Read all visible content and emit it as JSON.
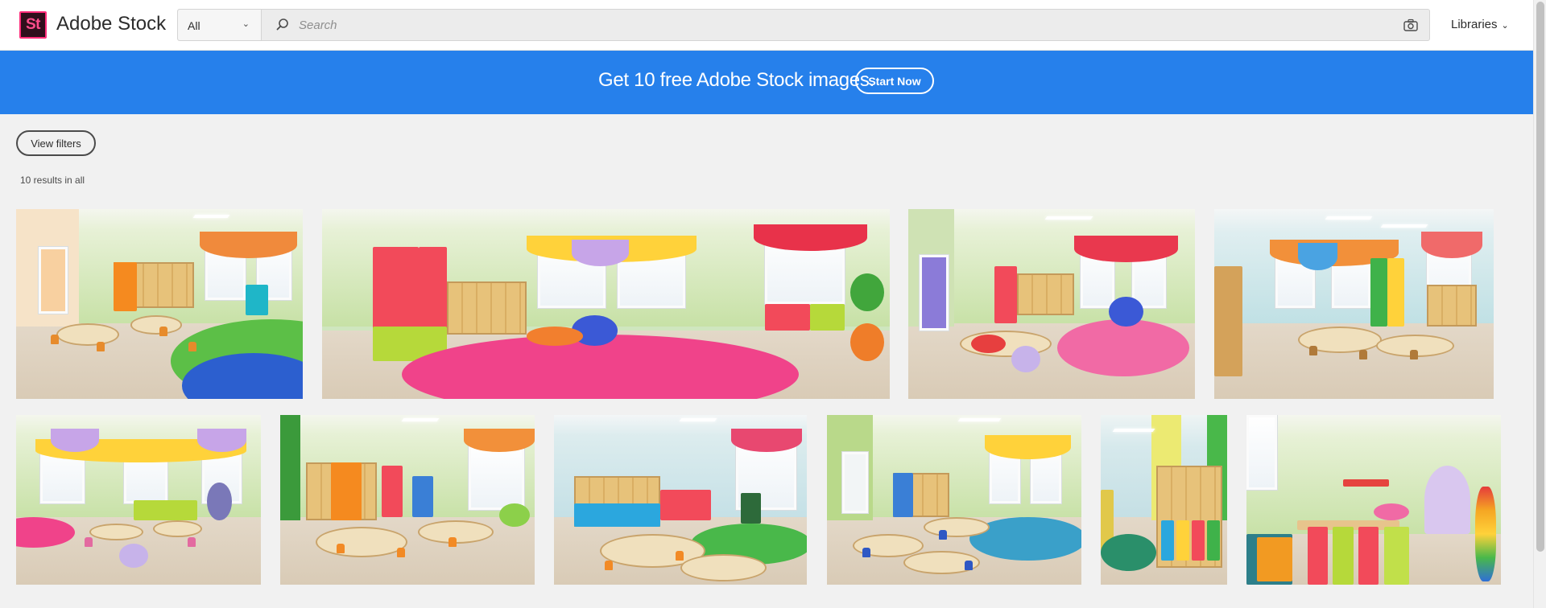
{
  "header": {
    "logo_text": "St",
    "brand": "Adobe Stock",
    "filter_value": "All",
    "search_placeholder": "Search",
    "libraries_label": "Libraries"
  },
  "banner": {
    "text": "Get 10 free Adobe Stock images.",
    "button_label": "Start Now",
    "color": "#2680eb"
  },
  "filters": {
    "view_filters_label": "View filters",
    "results_text": "10 results in all"
  },
  "icons": {
    "search": "search-icon",
    "camera": "camera-icon",
    "chevron": "chevron-down-icon"
  },
  "results": [
    {
      "subject": "kindergarten classroom"
    },
    {
      "subject": "kindergarten playroom"
    },
    {
      "subject": "kindergarten classroom"
    },
    {
      "subject": "kindergarten classroom"
    },
    {
      "subject": "kindergarten classroom"
    },
    {
      "subject": "kindergarten classroom"
    },
    {
      "subject": "kindergarten classroom"
    },
    {
      "subject": "kindergarten classroom"
    },
    {
      "subject": "kindergarten cloakroom"
    },
    {
      "subject": "kindergarten play corner"
    }
  ]
}
